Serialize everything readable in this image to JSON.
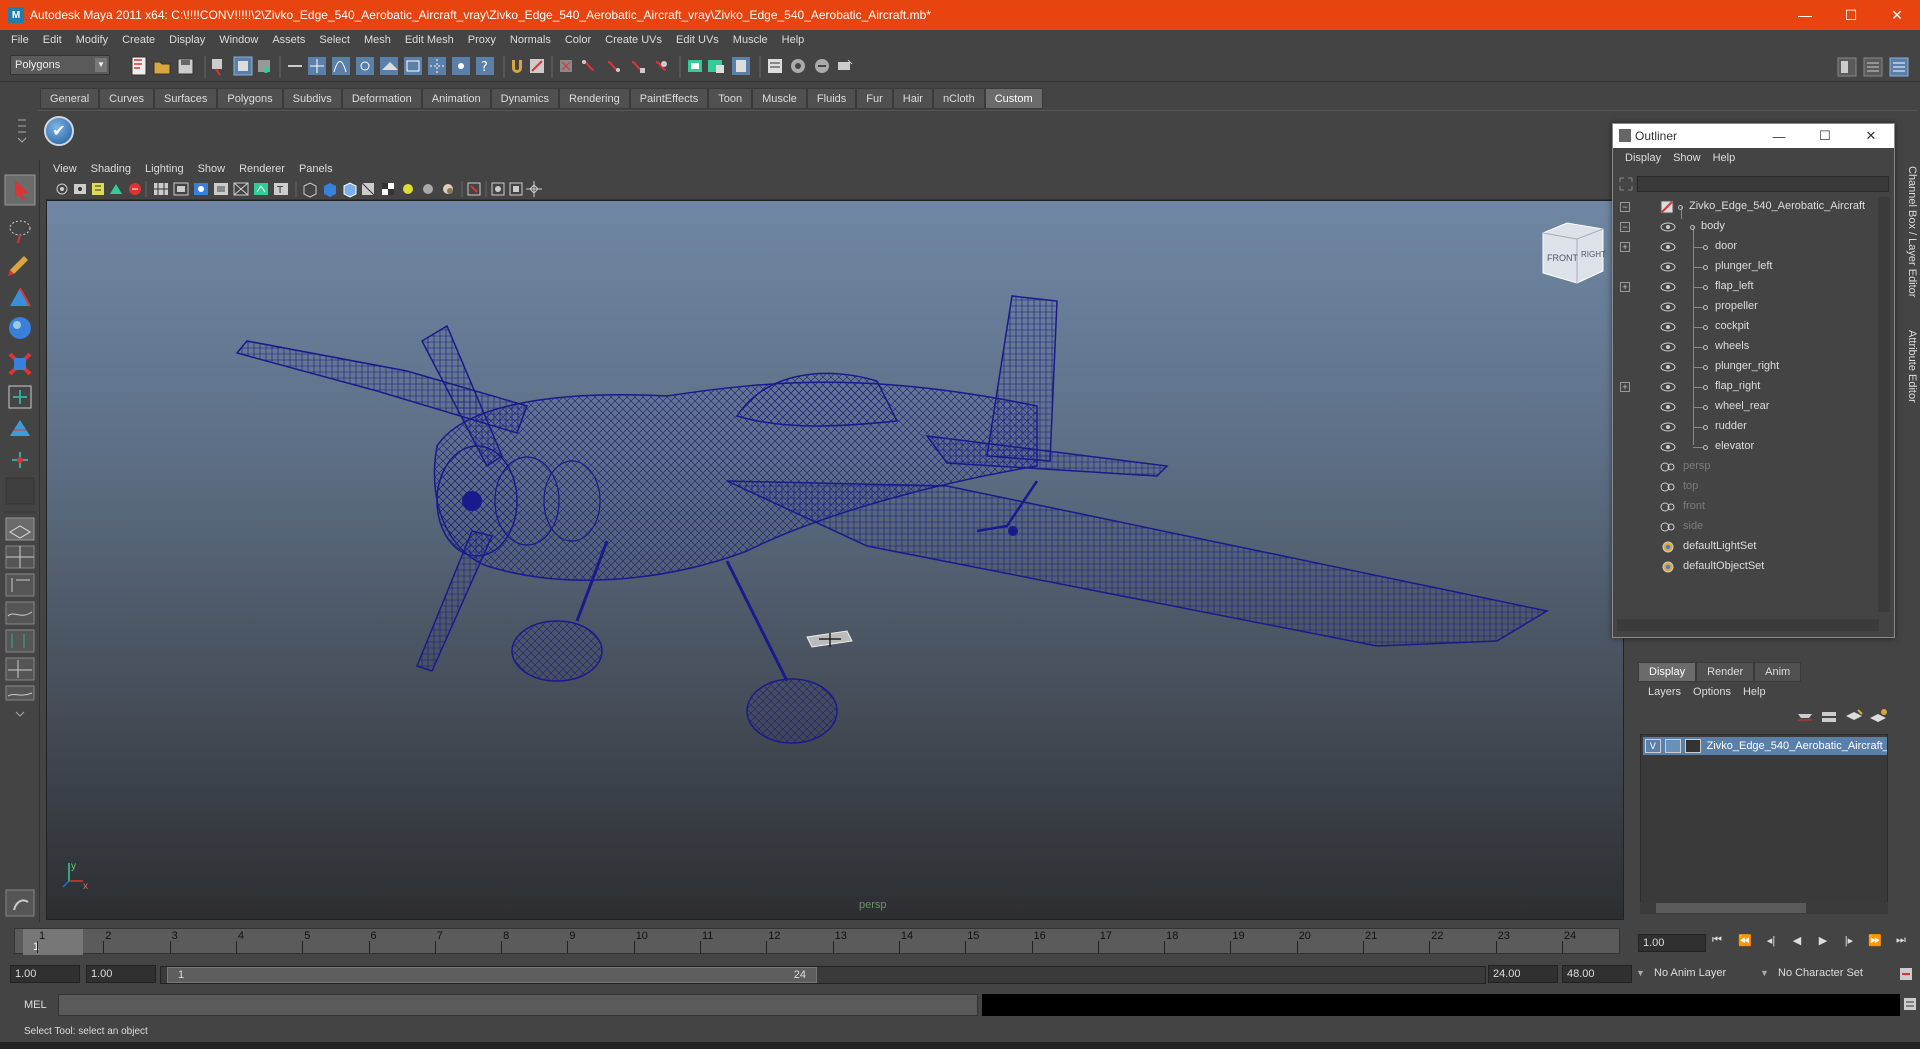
{
  "window": {
    "title": "Autodesk Maya 2011 x64: C:\\!!!!CONV!!!!!\\2\\Zivko_Edge_540_Aerobatic_Aircraft_vray\\Zivko_Edge_540_Aerobatic_Aircraft_vray\\Zivko_Edge_540_Aerobatic_Aircraft.mb*",
    "app_icon": "M",
    "minimize": "—",
    "maximize": "☐",
    "close": "✕"
  },
  "menubar": [
    "File",
    "Edit",
    "Modify",
    "Create",
    "Display",
    "Window",
    "Assets",
    "Select",
    "Mesh",
    "Edit Mesh",
    "Proxy",
    "Normals",
    "Color",
    "Create UVs",
    "Edit UVs",
    "Muscle",
    "Help"
  ],
  "statusline": {
    "mode": "Polygons"
  },
  "shelf": {
    "tabs": [
      "General",
      "Curves",
      "Surfaces",
      "Polygons",
      "Subdivs",
      "Deformation",
      "Animation",
      "Dynamics",
      "Rendering",
      "PaintEffects",
      "Toon",
      "Muscle",
      "Fluids",
      "Fur",
      "Hair",
      "nCloth",
      "Custom"
    ],
    "active_tab": "Custom"
  },
  "panel_menu": [
    "View",
    "Shading",
    "Lighting",
    "Show",
    "Renderer",
    "Panels"
  ],
  "viewport": {
    "camera": "persp",
    "viewcube_front": "FRONT",
    "viewcube_right": "RIGHT",
    "axis_x": "x",
    "axis_y": "y",
    "wire_color": "#1a1a8c"
  },
  "outliner": {
    "title": "Outliner",
    "min": "—",
    "max": "☐",
    "close": "✕",
    "menu": [
      "Display",
      "Show",
      "Help"
    ],
    "root": "Zivko_Edge_540_Aerobatic_Aircraft",
    "body": "body",
    "children": [
      "door",
      "plunger_left",
      "flap_left",
      "propeller",
      "cockpit",
      "wheels",
      "plunger_right",
      "flap_right",
      "wheel_rear",
      "rudder",
      "elevator"
    ],
    "cameras": [
      "persp",
      "top",
      "front",
      "side"
    ],
    "sets": [
      "defaultLightSet",
      "defaultObjectSet"
    ]
  },
  "side_tabs": {
    "channel_box": "Channel Box / Layer Editor",
    "attribute_editor": "Attribute Editor"
  },
  "layer_editor": {
    "tabs": [
      "Display",
      "Render",
      "Anim"
    ],
    "active_tab": "Display",
    "menu": [
      "Layers",
      "Options",
      "Help"
    ],
    "layer": {
      "visible": "V",
      "name": "Zivko_Edge_540_Aerobatic_Aircraft_"
    }
  },
  "timeline": {
    "ticks": [
      "1",
      "2",
      "3",
      "4",
      "5",
      "6",
      "7",
      "8",
      "9",
      "10",
      "11",
      "12",
      "13",
      "14",
      "15",
      "16",
      "17",
      "18",
      "19",
      "20",
      "21",
      "22",
      "23",
      "24"
    ],
    "current_frame_marker": "1",
    "current_time": "1.00"
  },
  "range": {
    "start": "1.00",
    "playback_start": "1.00",
    "handle_start": "1",
    "handle_end": "24",
    "playback_end": "24.00",
    "end": "48.00",
    "anim_layer": "No Anim Layer",
    "character_set": "No Character Set"
  },
  "command": {
    "label": "MEL"
  },
  "helpline": {
    "text": "Select Tool: select an object"
  }
}
